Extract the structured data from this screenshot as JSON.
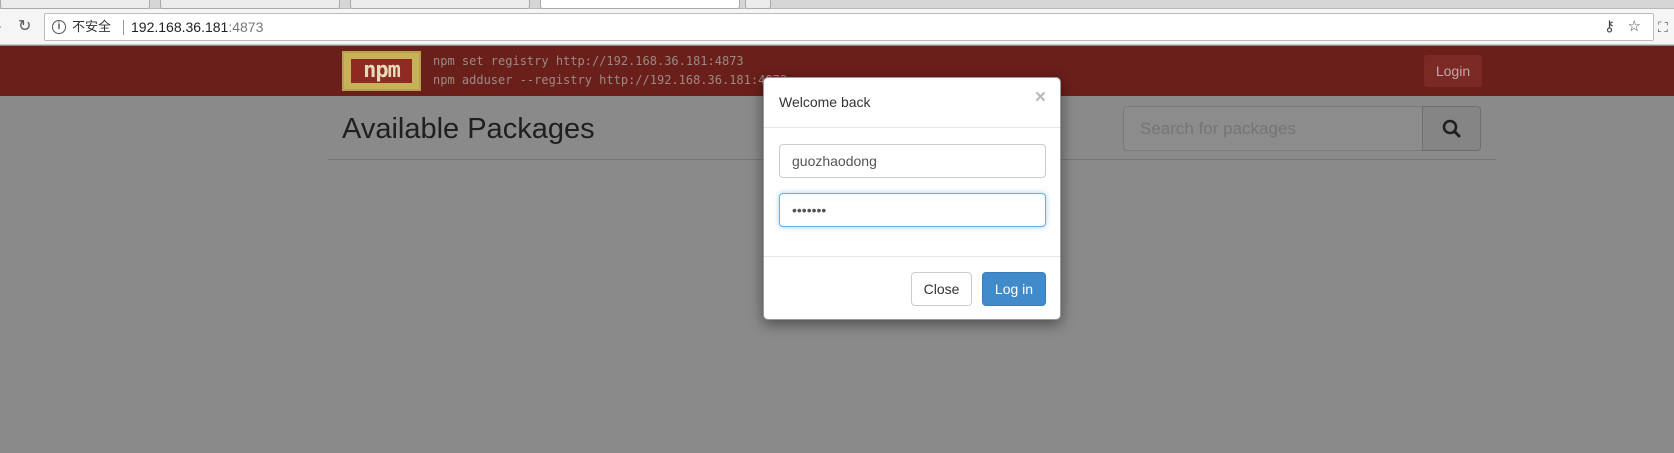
{
  "browser": {
    "security_label": "不安全",
    "url_host": "192.168.36.181",
    "url_port": ":4873"
  },
  "header": {
    "logo_text": "npm",
    "cmd_registry": "npm set registry http://192.168.36.181:4873",
    "cmd_adduser": "npm adduser --registry http://192.168.36.181:4873",
    "login_label": "Login"
  },
  "main": {
    "title": "Available Packages",
    "search_placeholder": "Search for packages"
  },
  "modal": {
    "title": "Welcome back",
    "close_symbol": "×",
    "username_value": "guozhaodong",
    "password_value": "•••••••",
    "close_label": "Close",
    "login_label": "Log in"
  },
  "colors": {
    "navbar": "#6a1f1a",
    "primary_button": "#428bca",
    "overlay": "#8a8a8a"
  }
}
